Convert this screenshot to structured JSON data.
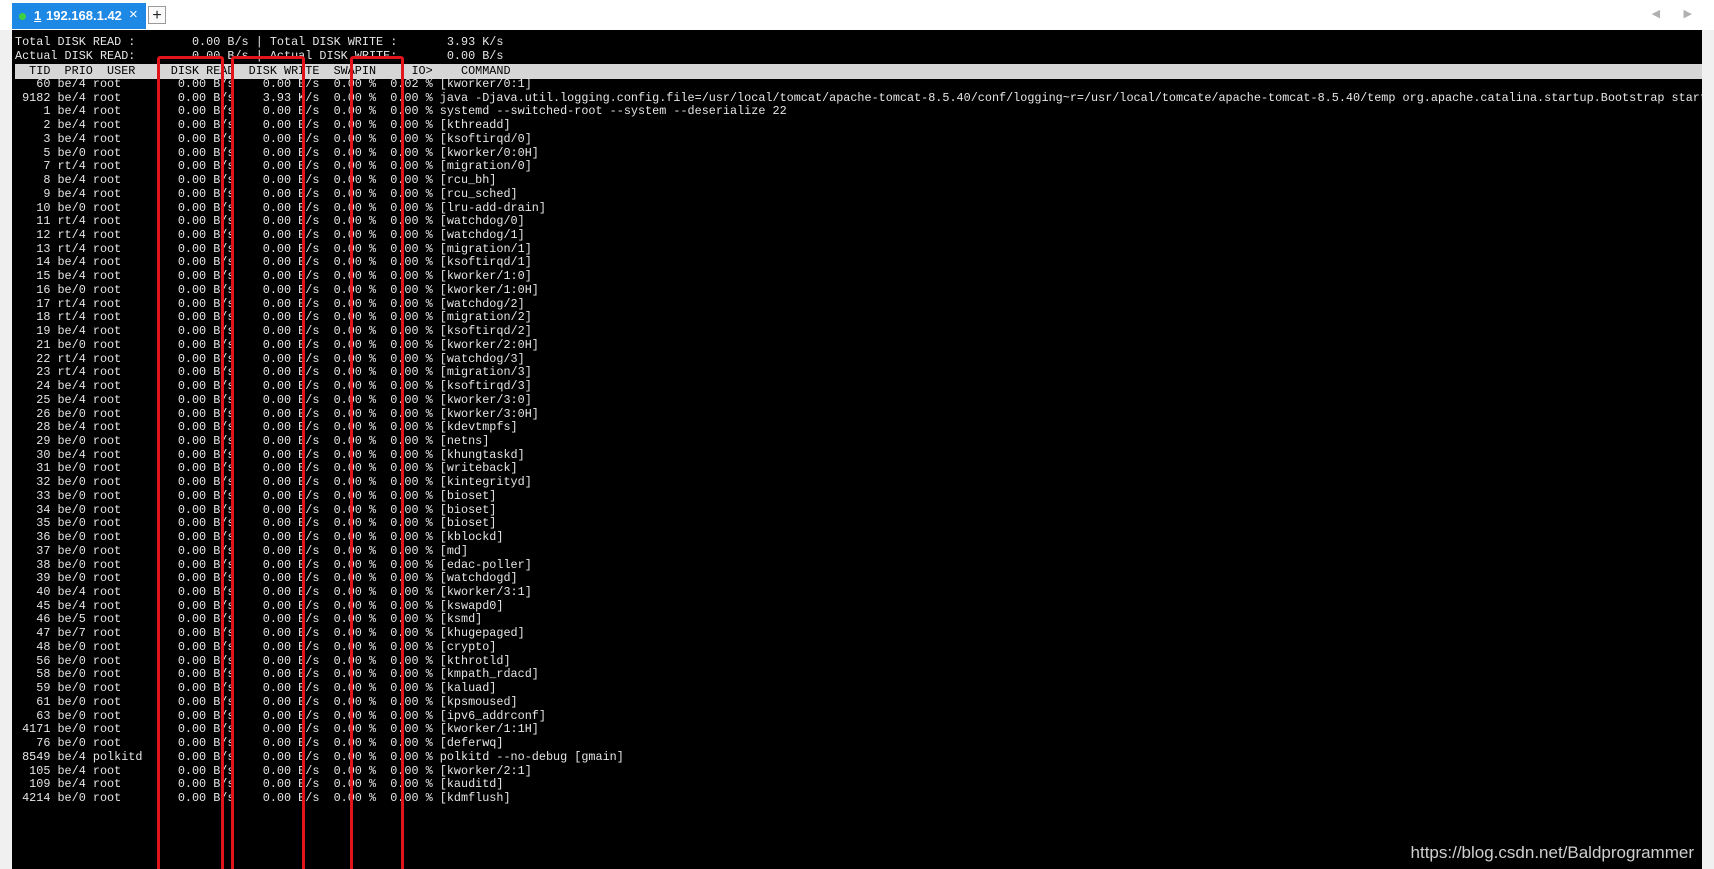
{
  "tab": {
    "number": "1",
    "title": "192.168.1.42",
    "close": "×"
  },
  "new_tab": "+",
  "nav_arrows": "◀ ▶",
  "colors": {
    "tab_bg": "#1e88e5",
    "status_dot": "#3fd13f",
    "header_bg": "#d6d6d6",
    "highlight": "#e0141a"
  },
  "summary": {
    "line1": "Total DISK READ :        0.00 B/s | Total DISK WRITE :       3.93 K/s",
    "line2": "Actual DISK READ:        0.00 B/s | Actual DISK WRITE:       0.00 B/s"
  },
  "header": "  TID  PRIO  USER     DISK READ  DISK WRITE  SWAPIN     IO>    COMMAND",
  "rows": [
    "   60 be/4 root        0.00 B/s    0.00 B/s  0.00 %  0.02 % [kworker/0:1]",
    " 9182 be/4 root        0.00 B/s    3.93 K/s  0.00 %  0.00 % java -Djava.util.logging.config.file=/usr/local/tomcat/apache-tomcat-8.5.40/conf/logging~r=/usr/local/tomcate/apache-tomcat-8.5.40/temp org.apache.catalina.startup.Bootstrap start",
    "    1 be/4 root        0.00 B/s    0.00 B/s  0.00 %  0.00 % systemd --switched-root --system --deserialize 22",
    "    2 be/4 root        0.00 B/s    0.00 B/s  0.00 %  0.00 % [kthreadd]",
    "    3 be/4 root        0.00 B/s    0.00 B/s  0.00 %  0.00 % [ksoftirqd/0]",
    "    5 be/0 root        0.00 B/s    0.00 B/s  0.00 %  0.00 % [kworker/0:0H]",
    "    7 rt/4 root        0.00 B/s    0.00 B/s  0.00 %  0.00 % [migration/0]",
    "    8 be/4 root        0.00 B/s    0.00 B/s  0.00 %  0.00 % [rcu_bh]",
    "    9 be/4 root        0.00 B/s    0.00 B/s  0.00 %  0.00 % [rcu_sched]",
    "   10 be/0 root        0.00 B/s    0.00 B/s  0.00 %  0.00 % [lru-add-drain]",
    "   11 rt/4 root        0.00 B/s    0.00 B/s  0.00 %  0.00 % [watchdog/0]",
    "   12 rt/4 root        0.00 B/s    0.00 B/s  0.00 %  0.00 % [watchdog/1]",
    "   13 rt/4 root        0.00 B/s    0.00 B/s  0.00 %  0.00 % [migration/1]",
    "   14 be/4 root        0.00 B/s    0.00 B/s  0.00 %  0.00 % [ksoftirqd/1]",
    "   15 be/4 root        0.00 B/s    0.00 B/s  0.00 %  0.00 % [kworker/1:0]",
    "   16 be/0 root        0.00 B/s    0.00 B/s  0.00 %  0.00 % [kworker/1:0H]",
    "   17 rt/4 root        0.00 B/s    0.00 B/s  0.00 %  0.00 % [watchdog/2]",
    "   18 rt/4 root        0.00 B/s    0.00 B/s  0.00 %  0.00 % [migration/2]",
    "   19 be/4 root        0.00 B/s    0.00 B/s  0.00 %  0.00 % [ksoftirqd/2]",
    "   21 be/0 root        0.00 B/s    0.00 B/s  0.00 %  0.00 % [kworker/2:0H]",
    "   22 rt/4 root        0.00 B/s    0.00 B/s  0.00 %  0.00 % [watchdog/3]",
    "   23 rt/4 root        0.00 B/s    0.00 B/s  0.00 %  0.00 % [migration/3]",
    "   24 be/4 root        0.00 B/s    0.00 B/s  0.00 %  0.00 % [ksoftirqd/3]",
    "   25 be/4 root        0.00 B/s    0.00 B/s  0.00 %  0.00 % [kworker/3:0]",
    "   26 be/0 root        0.00 B/s    0.00 B/s  0.00 %  0.00 % [kworker/3:0H]",
    "   28 be/4 root        0.00 B/s    0.00 B/s  0.00 %  0.00 % [kdevtmpfs]",
    "   29 be/0 root        0.00 B/s    0.00 B/s  0.00 %  0.00 % [netns]",
    "   30 be/4 root        0.00 B/s    0.00 B/s  0.00 %  0.00 % [khungtaskd]",
    "   31 be/0 root        0.00 B/s    0.00 B/s  0.00 %  0.00 % [writeback]",
    "   32 be/0 root        0.00 B/s    0.00 B/s  0.00 %  0.00 % [kintegrityd]",
    "   33 be/0 root        0.00 B/s    0.00 B/s  0.00 %  0.00 % [bioset]",
    "   34 be/0 root        0.00 B/s    0.00 B/s  0.00 %  0.00 % [bioset]",
    "   35 be/0 root        0.00 B/s    0.00 B/s  0.00 %  0.00 % [bioset]",
    "   36 be/0 root        0.00 B/s    0.00 B/s  0.00 %  0.00 % [kblockd]",
    "   37 be/0 root        0.00 B/s    0.00 B/s  0.00 %  0.00 % [md]",
    "   38 be/0 root        0.00 B/s    0.00 B/s  0.00 %  0.00 % [edac-poller]",
    "   39 be/0 root        0.00 B/s    0.00 B/s  0.00 %  0.00 % [watchdogd]",
    "   40 be/4 root        0.00 B/s    0.00 B/s  0.00 %  0.00 % [kworker/3:1]",
    "   45 be/4 root        0.00 B/s    0.00 B/s  0.00 %  0.00 % [kswapd0]",
    "   46 be/5 root        0.00 B/s    0.00 B/s  0.00 %  0.00 % [ksmd]",
    "   47 be/7 root        0.00 B/s    0.00 B/s  0.00 %  0.00 % [khugepaged]",
    "   48 be/0 root        0.00 B/s    0.00 B/s  0.00 %  0.00 % [crypto]",
    "   56 be/0 root        0.00 B/s    0.00 B/s  0.00 %  0.00 % [kthrotld]",
    "   58 be/0 root        0.00 B/s    0.00 B/s  0.00 %  0.00 % [kmpath_rdacd]",
    "   59 be/0 root        0.00 B/s    0.00 B/s  0.00 %  0.00 % [kaluad]",
    "   61 be/0 root        0.00 B/s    0.00 B/s  0.00 %  0.00 % [kpsmoused]",
    "   63 be/0 root        0.00 B/s    0.00 B/s  0.00 %  0.00 % [ipv6_addrconf]",
    " 4171 be/0 root        0.00 B/s    0.00 B/s  0.00 %  0.00 % [kworker/1:1H]",
    "   76 be/0 root        0.00 B/s    0.00 B/s  0.00 %  0.00 % [deferwq]",
    " 8549 be/4 polkitd     0.00 B/s    0.00 B/s  0.00 %  0.00 % polkitd --no-debug [gmain]",
    "  105 be/4 root        0.00 B/s    0.00 B/s  0.00 %  0.00 % [kworker/2:1]",
    "  109 be/4 root        0.00 B/s    0.00 B/s  0.00 %  0.00 % [kauditd]",
    " 4214 be/0 root        0.00 B/s    0.00 B/s  0.00 %  0.00 % [kdmflush]"
  ],
  "watermark": "https://blog.csdn.net/Baldprogrammer"
}
